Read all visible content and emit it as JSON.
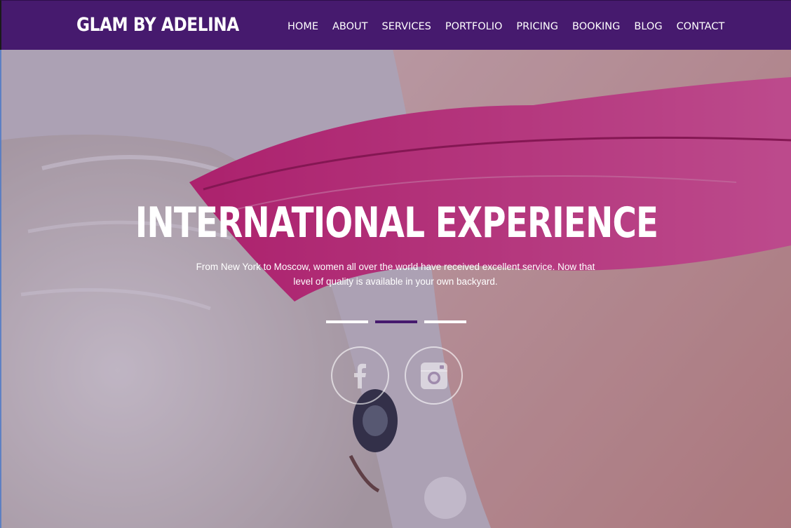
{
  "brand": {
    "logo": "GLAM BY ADELINA"
  },
  "nav": [
    "HOME",
    "ABOUT",
    "SERVICES",
    "PORTFOLIO",
    "PRICING",
    "BOOKING",
    "BLOG",
    "CONTACT"
  ],
  "hero": {
    "headline": "INTERNATIONAL EXPERIENCE",
    "subtext": "From New York to Moscow, women all over the world have received excellent service. Now that level of quality is available in your own backyard.",
    "slides": {
      "count": 3,
      "active_index": 1
    },
    "social": [
      "facebook-icon",
      "instagram-icon"
    ]
  },
  "colors": {
    "brand_purple": "#461a6e",
    "feather_pink": "#e5287e"
  }
}
